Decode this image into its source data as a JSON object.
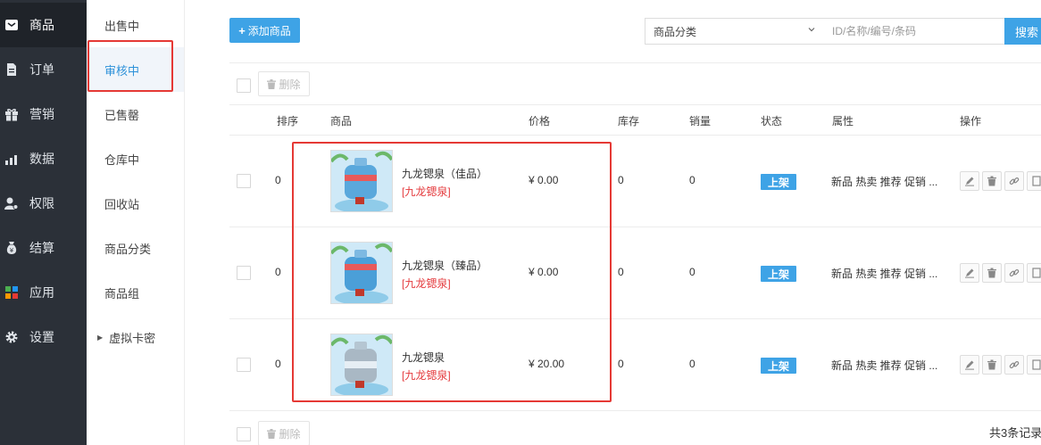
{
  "sidebar": {
    "items": [
      {
        "label": "商品",
        "icon": "product-icon",
        "active": true
      },
      {
        "label": "订单",
        "icon": "order-icon"
      },
      {
        "label": "营销",
        "icon": "gift-icon"
      },
      {
        "label": "数据",
        "icon": "chart-icon"
      },
      {
        "label": "权限",
        "icon": "user-permission-icon"
      },
      {
        "label": "结算",
        "icon": "money-bag-icon"
      },
      {
        "label": "应用",
        "icon": "apps-icon"
      },
      {
        "label": "设置",
        "icon": "gear-icon"
      }
    ]
  },
  "subnav": {
    "items": [
      {
        "label": "出售中"
      },
      {
        "label": "审核中",
        "active": true
      },
      {
        "label": "已售罄"
      },
      {
        "label": "仓库中"
      },
      {
        "label": "回收站"
      },
      {
        "label": "商品分类"
      },
      {
        "label": "商品组"
      },
      {
        "label": "虚拟卡密",
        "expandable": true
      }
    ]
  },
  "toolbar": {
    "add_label": "添加商品",
    "category_select": "商品分类",
    "search_placeholder": "ID/名称/编号/条码",
    "search_label": "搜索"
  },
  "bulk": {
    "delete_label": "删除"
  },
  "table": {
    "headers": {
      "sort": "排序",
      "product": "商品",
      "price": "价格",
      "stock": "库存",
      "sales": "销量",
      "status": "状态",
      "attributes": "属性",
      "actions": "操作"
    },
    "rows": [
      {
        "sort": "0",
        "name": "九龙锶泉（佳品）",
        "brand": "[九龙锶泉]",
        "price": "¥ 0.00",
        "stock": "0",
        "sales": "0",
        "status": "上架",
        "attributes": "新品 热卖 推荐 促销 ..."
      },
      {
        "sort": "0",
        "name": "九龙锶泉（臻品）",
        "brand": "[九龙锶泉]",
        "price": "¥ 0.00",
        "stock": "0",
        "sales": "0",
        "status": "上架",
        "attributes": "新品 热卖 推荐 促销 ..."
      },
      {
        "sort": "0",
        "name": "九龙锶泉",
        "brand": "[九龙锶泉]",
        "price": "¥ 20.00",
        "stock": "0",
        "sales": "0",
        "status": "上架",
        "attributes": "新品 热卖 推荐 促销 ..."
      }
    ]
  },
  "footer": {
    "total_label": "共3条记录"
  },
  "colors": {
    "accent": "#3ea3e6",
    "sidebar_bg": "#2b3038",
    "highlight_border": "#e53935",
    "brand_text": "#e4393c"
  }
}
